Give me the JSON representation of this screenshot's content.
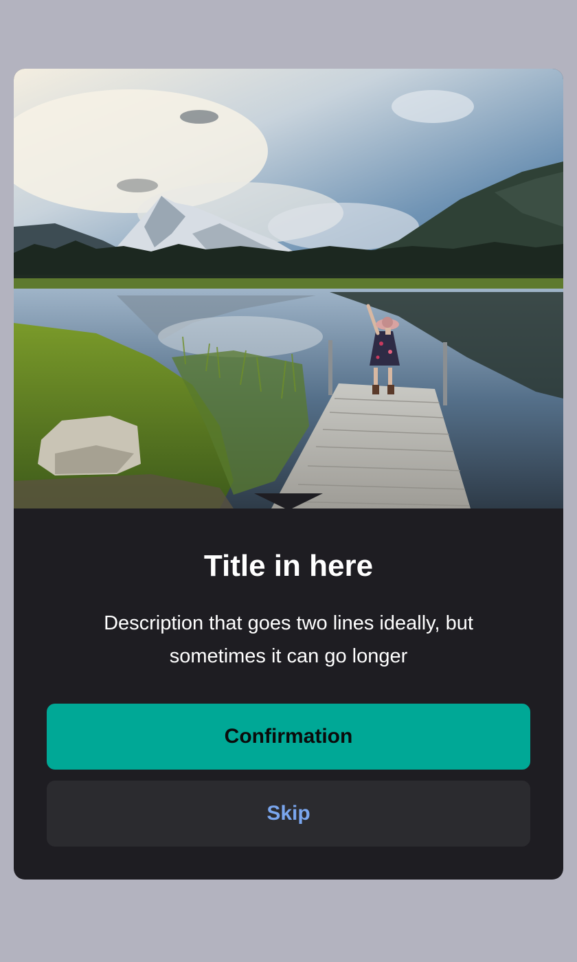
{
  "dialog": {
    "image": {
      "alt": "Person standing on a wooden dock at a mountain lake"
    },
    "title": "Title in here",
    "description": "Description that goes two lines ideally, but sometimes it can go longer",
    "primary_button": {
      "label": "Confirmation"
    },
    "secondary_button": {
      "label": "Skip"
    }
  },
  "colors": {
    "backdrop": "#b3b3bf",
    "dialog_background": "#1e1d22",
    "primary_button": "#00a896",
    "secondary_button": "#2b2b2f",
    "secondary_button_text": "#7aa6ee"
  }
}
